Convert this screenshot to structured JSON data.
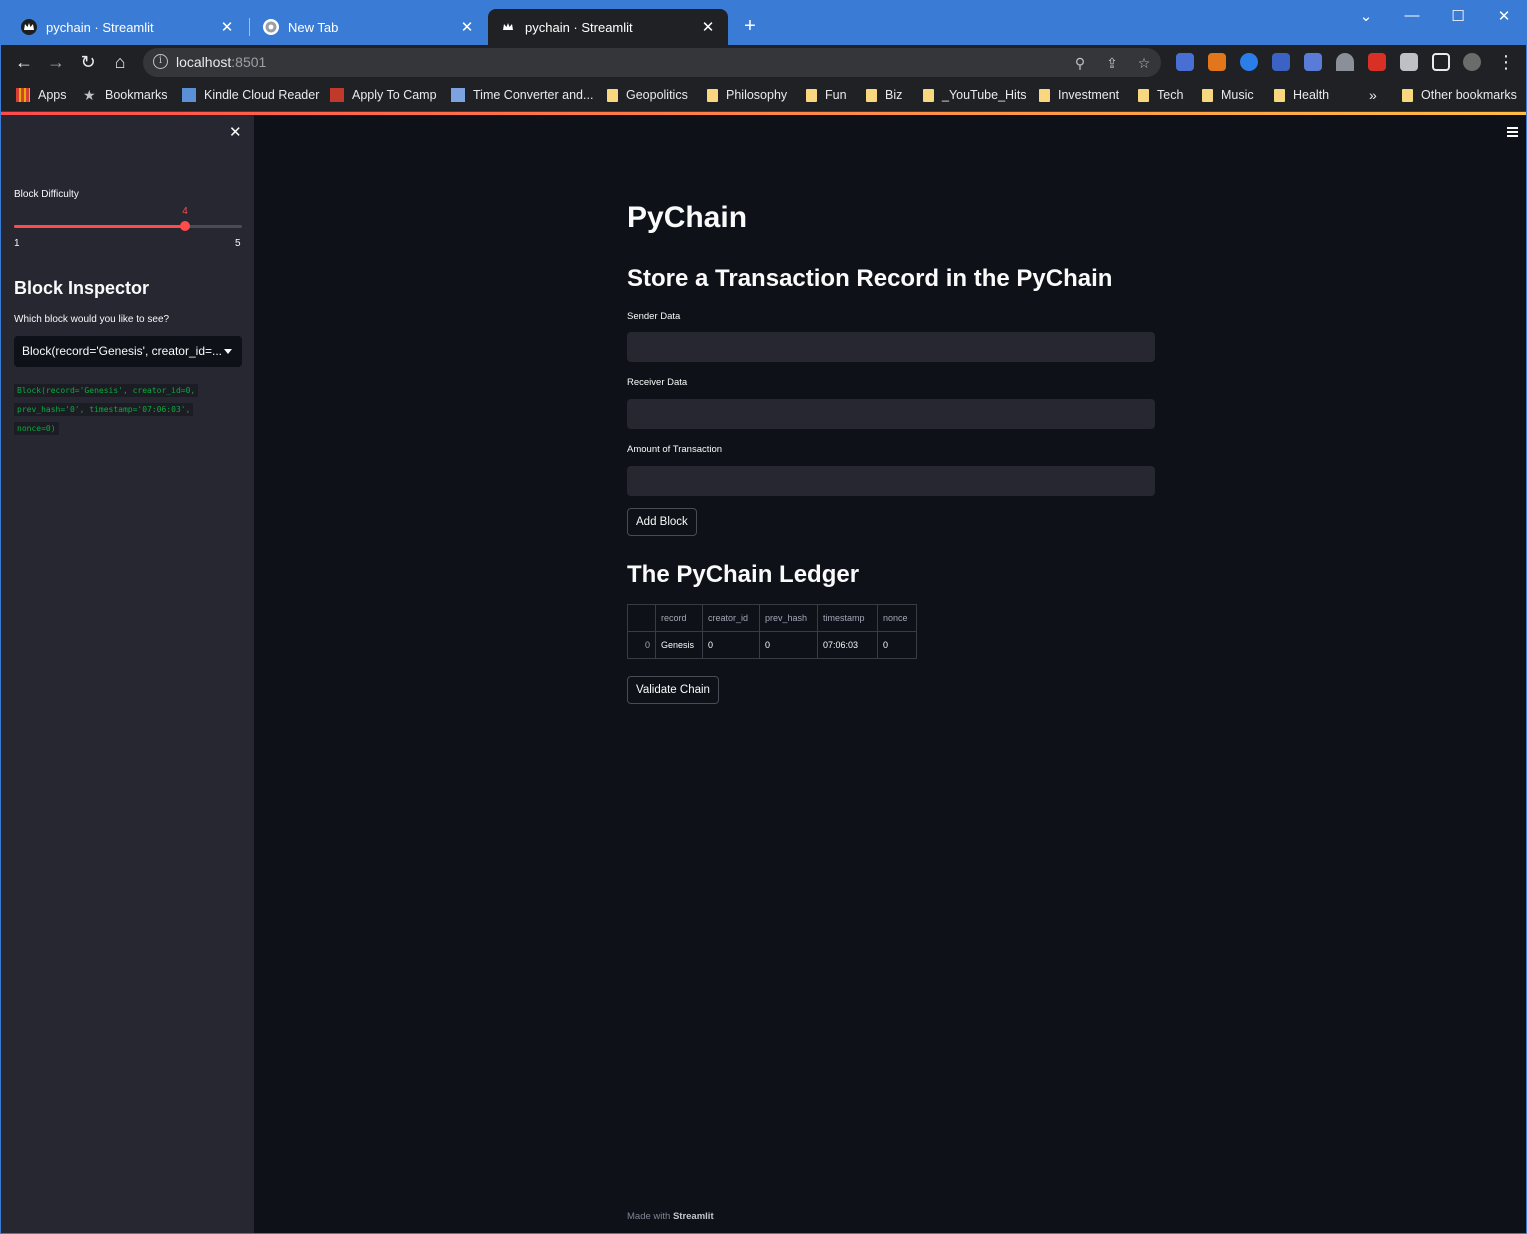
{
  "browser": {
    "tabs": [
      {
        "title": "pychain · Streamlit"
      },
      {
        "title": "New Tab"
      },
      {
        "title": "pychain · Streamlit"
      }
    ],
    "url_host": "localhost",
    "url_port": ":8501",
    "bookmarks": [
      {
        "label": "Apps",
        "icon": "apps-grid-icon"
      },
      {
        "label": "Bookmarks",
        "icon": "star-icon"
      },
      {
        "label": "Kindle Cloud Reader",
        "icon": "kindle-icon"
      },
      {
        "label": "Apply To Camp",
        "icon": "camp-icon"
      },
      {
        "label": "Time Converter and...",
        "icon": "clock-icon"
      },
      {
        "label": "Geopolitics",
        "icon": "folder-icon"
      },
      {
        "label": "Philosophy",
        "icon": "folder-icon"
      },
      {
        "label": "Fun",
        "icon": "folder-icon"
      },
      {
        "label": "Biz",
        "icon": "folder-icon"
      },
      {
        "label": "_YouTube_Hits",
        "icon": "folder-icon"
      },
      {
        "label": "Investment",
        "icon": "folder-icon"
      },
      {
        "label": "Tech",
        "icon": "folder-icon"
      },
      {
        "label": "Music",
        "icon": "folder-icon"
      },
      {
        "label": "Health",
        "icon": "folder-icon"
      }
    ],
    "overflow": "»",
    "other_bookmarks": "Other bookmarks"
  },
  "sidebar": {
    "difficulty_label": "Block Difficulty",
    "slider": {
      "min": 1,
      "max": 5,
      "value": 4,
      "min_label": "1",
      "max_label": "5",
      "value_label": "4"
    },
    "inspector_title": "Block Inspector",
    "select_label": "Which block would you like to see?",
    "select_value": "Block(record='Genesis', creator_id=...",
    "code_lines": [
      "Block(record='Genesis', creator_id=0,",
      "prev_hash='0', timestamp='07:06:03',",
      "nonce=0)"
    ]
  },
  "main": {
    "title": "PyChain",
    "form_title": "Store a Transaction Record in the PyChain",
    "sender_label": "Sender Data",
    "receiver_label": "Receiver Data",
    "amount_label": "Amount of Transaction",
    "add_button": "Add Block",
    "ledger_title": "The PyChain Ledger",
    "ledger": {
      "columns": [
        "",
        "record",
        "creator_id",
        "prev_hash",
        "timestamp",
        "nonce"
      ],
      "rows": [
        [
          "0",
          "Genesis",
          "0",
          "0",
          "07:06:03",
          "0"
        ]
      ]
    },
    "validate_button": "Validate Chain",
    "footer_prefix": "Made with",
    "footer_brand": "Streamlit"
  },
  "colors": {
    "accent": "#ff4b4b",
    "background": "#0e1117",
    "sidebar": "#262730",
    "code": "#09ab3b",
    "browser_frame": "#3a7bd5"
  }
}
